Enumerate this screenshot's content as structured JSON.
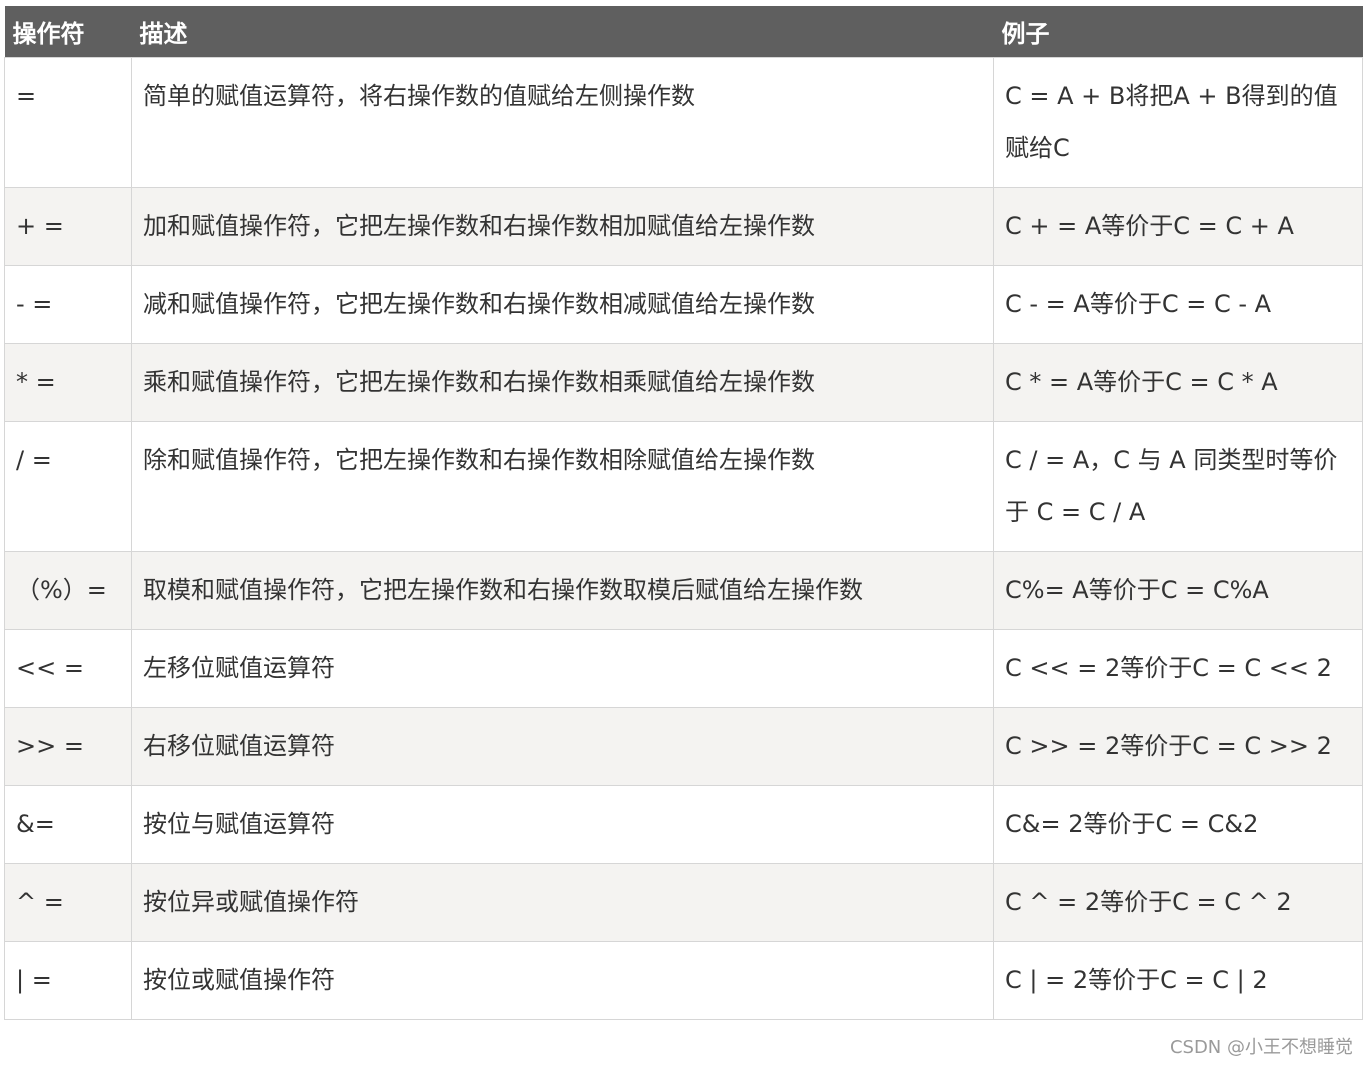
{
  "headers": {
    "operator": "操作符",
    "description": "描述",
    "example": "例子"
  },
  "rows": [
    {
      "op": "=",
      "desc": "简单的赋值运算符，将右操作数的值赋给左侧操作数",
      "example": "C = A + B将把A + B得到的值赋给C"
    },
    {
      "op": "+ =",
      "desc": "加和赋值操作符，它把左操作数和右操作数相加赋值给左操作数",
      "example": "C + = A等价于C = C + A"
    },
    {
      "op": "- =",
      "desc": "减和赋值操作符，它把左操作数和右操作数相减赋值给左操作数",
      "example": "C - = A等价于C = C - A"
    },
    {
      "op": "* =",
      "desc": "乘和赋值操作符，它把左操作数和右操作数相乘赋值给左操作数",
      "example": "C * = A等价于C = C * A"
    },
    {
      "op": "/ =",
      "desc": "除和赋值操作符，它把左操作数和右操作数相除赋值给左操作数",
      "example": "C / = A，C 与 A 同类型时等价于 C = C / A"
    },
    {
      "op": "（%）=",
      "desc": "取模和赋值操作符，它把左操作数和右操作数取模后赋值给左操作数",
      "example": "C%= A等价于C = C%A"
    },
    {
      "op": "<< =",
      "desc": "左移位赋值运算符",
      "example": "C << = 2等价于C = C << 2"
    },
    {
      "op": ">> =",
      "desc": "右移位赋值运算符",
      "example": "C >> = 2等价于C = C >> 2"
    },
    {
      "op": "&=",
      "desc": "按位与赋值运算符",
      "example": "C&= 2等价于C = C&2"
    },
    {
      "op": "^ =",
      "desc": "按位异或赋值操作符",
      "example": "C ^ = 2等价于C = C ^ 2"
    },
    {
      "op": "| =",
      "desc": "按位或赋值操作符",
      "example": "C | = 2等价于C = C | 2"
    }
  ],
  "watermark": "CSDN @小王不想睡觉"
}
